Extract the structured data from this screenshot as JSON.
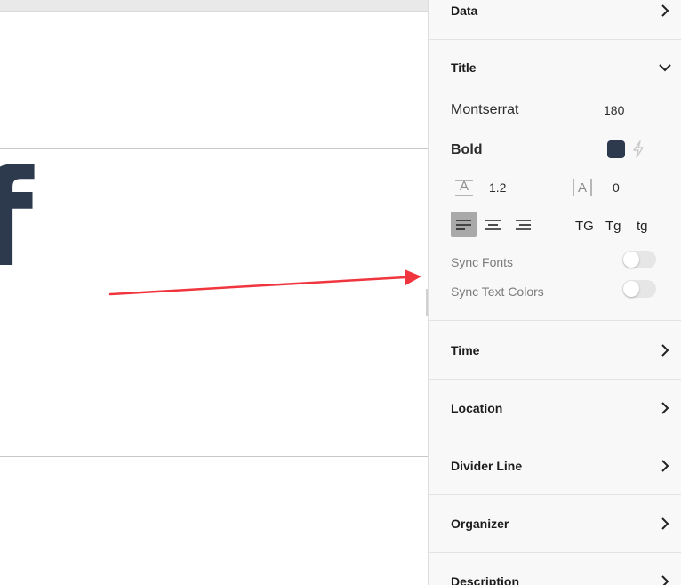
{
  "canvas": {
    "partial_glyph": "f",
    "arrow_color": "#f0353f"
  },
  "panel": {
    "sections_top": [
      {
        "label": "Data",
        "expanded": false
      }
    ],
    "title_section": {
      "label": "Title",
      "expanded": true,
      "font_name": "Montserrat",
      "font_size": "180",
      "font_weight": "Bold",
      "text_color": "#2d3a4e",
      "line_height": "1.2",
      "letter_spacing": "0",
      "alignment": "left",
      "case_options": [
        "TG",
        "Tg",
        "tg"
      ],
      "sync_fonts": {
        "label": "Sync Fonts",
        "on": false
      },
      "sync_text_colors": {
        "label": "Sync Text Colors",
        "on": false
      }
    },
    "sections_bottom": [
      {
        "label": "Time",
        "expanded": false
      },
      {
        "label": "Location",
        "expanded": false
      },
      {
        "label": "Divider Line",
        "expanded": false
      },
      {
        "label": "Organizer",
        "expanded": false
      },
      {
        "label": "Description",
        "expanded": false
      }
    ]
  }
}
